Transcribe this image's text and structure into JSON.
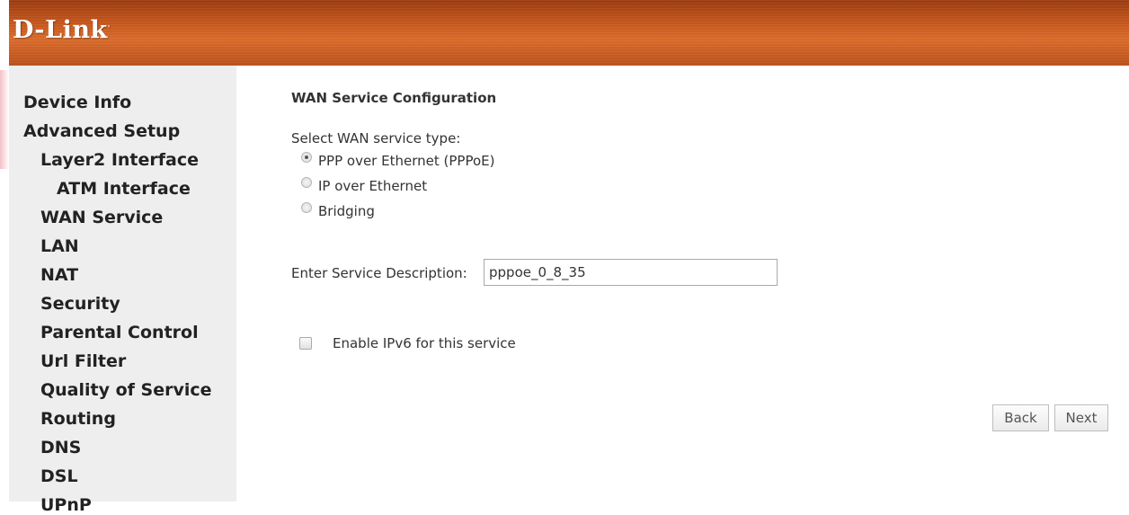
{
  "brand": {
    "logo_text": "D-Link",
    "logo_mark": "'"
  },
  "sidebar": {
    "items": [
      {
        "label": "Device Info"
      },
      {
        "label": "Advanced Setup"
      },
      {
        "label": "Layer2 Interface"
      },
      {
        "label": "ATM Interface"
      },
      {
        "label": "WAN Service"
      },
      {
        "label": "LAN"
      },
      {
        "label": "NAT"
      },
      {
        "label": "Security"
      },
      {
        "label": "Parental Control"
      },
      {
        "label": "Url Filter"
      },
      {
        "label": "Quality of Service"
      },
      {
        "label": "Routing"
      },
      {
        "label": "DNS"
      },
      {
        "label": "DSL"
      },
      {
        "label": "UPnP"
      }
    ]
  },
  "main": {
    "title": "WAN Service Configuration",
    "service_type_label": "Select WAN service type:",
    "service_types": [
      {
        "label": "PPP over Ethernet (PPPoE)",
        "checked": true
      },
      {
        "label": "IP over Ethernet",
        "checked": false
      },
      {
        "label": "Bridging",
        "checked": false
      }
    ],
    "description_label": "Enter Service Description:",
    "description_value": "pppoe_0_8_35",
    "ipv6_label": "Enable IPv6 for this service",
    "ipv6_checked": false,
    "back_label": "Back",
    "next_label": "Next"
  },
  "colors": {
    "header_orange": "#c4561c",
    "sidebar_bg": "#eeeeee"
  }
}
